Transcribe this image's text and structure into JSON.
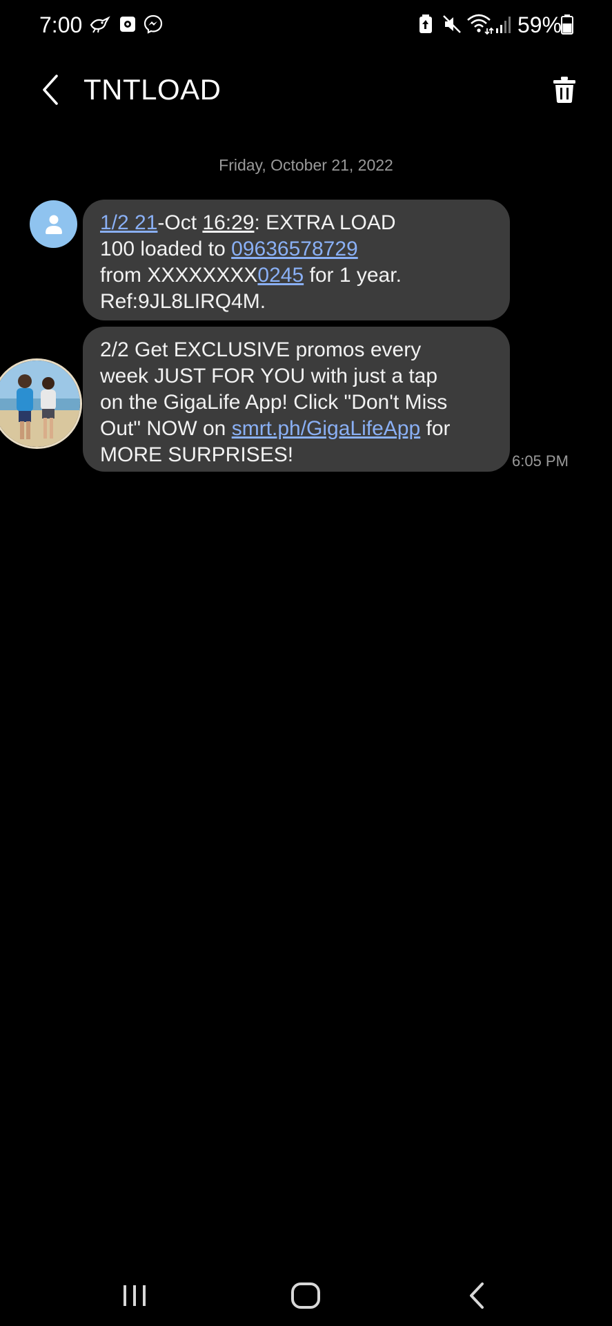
{
  "status_bar": {
    "time": "7:00",
    "battery_percent": "59%",
    "icons": [
      "bird-icon",
      "camera-app-icon",
      "messenger-icon",
      "battery-saver-icon",
      "mute-icon",
      "wifi-icon",
      "signal-icon",
      "battery-icon"
    ]
  },
  "header": {
    "title": "TNTLOAD",
    "back_icon": "chevron-left-icon",
    "delete_icon": "trash-icon"
  },
  "conversation": {
    "date": "Friday, October 21, 2022",
    "messages": [
      {
        "parts": {
          "p1": "1/2 21",
          "p2": "-Oct ",
          "p3": "16:29",
          "p4": ": EXTRA LOAD",
          "p5": "100 loaded to ",
          "p6": "09636578729",
          "p7": "from XXXXXXXX",
          "p8": "0245",
          "p9": " for 1 year.",
          "p10": "Ref:9JL8LIRQ4M."
        }
      },
      {
        "parts": {
          "p1": "2/2 Get EXCLUSIVE promos every",
          "p2": "week JUST FOR YOU with just a tap",
          "p3": "on the GigaLife App! Click \"Don't Miss",
          "p4": "Out\" NOW on ",
          "p5": "smrt.ph/GigaLifeApp",
          "p6": " for",
          "p7": "MORE SURPRISES!"
        },
        "time": "6:05 PM"
      }
    ]
  },
  "colors": {
    "background": "#000000",
    "bubble": "#3c3c3c",
    "link": "#8ab0f5",
    "avatar_default": "#8fc3ef",
    "muted_text": "#9a9a9a"
  },
  "nav_bar": {
    "icons": [
      "recent-apps-icon",
      "home-icon",
      "back-icon"
    ]
  }
}
